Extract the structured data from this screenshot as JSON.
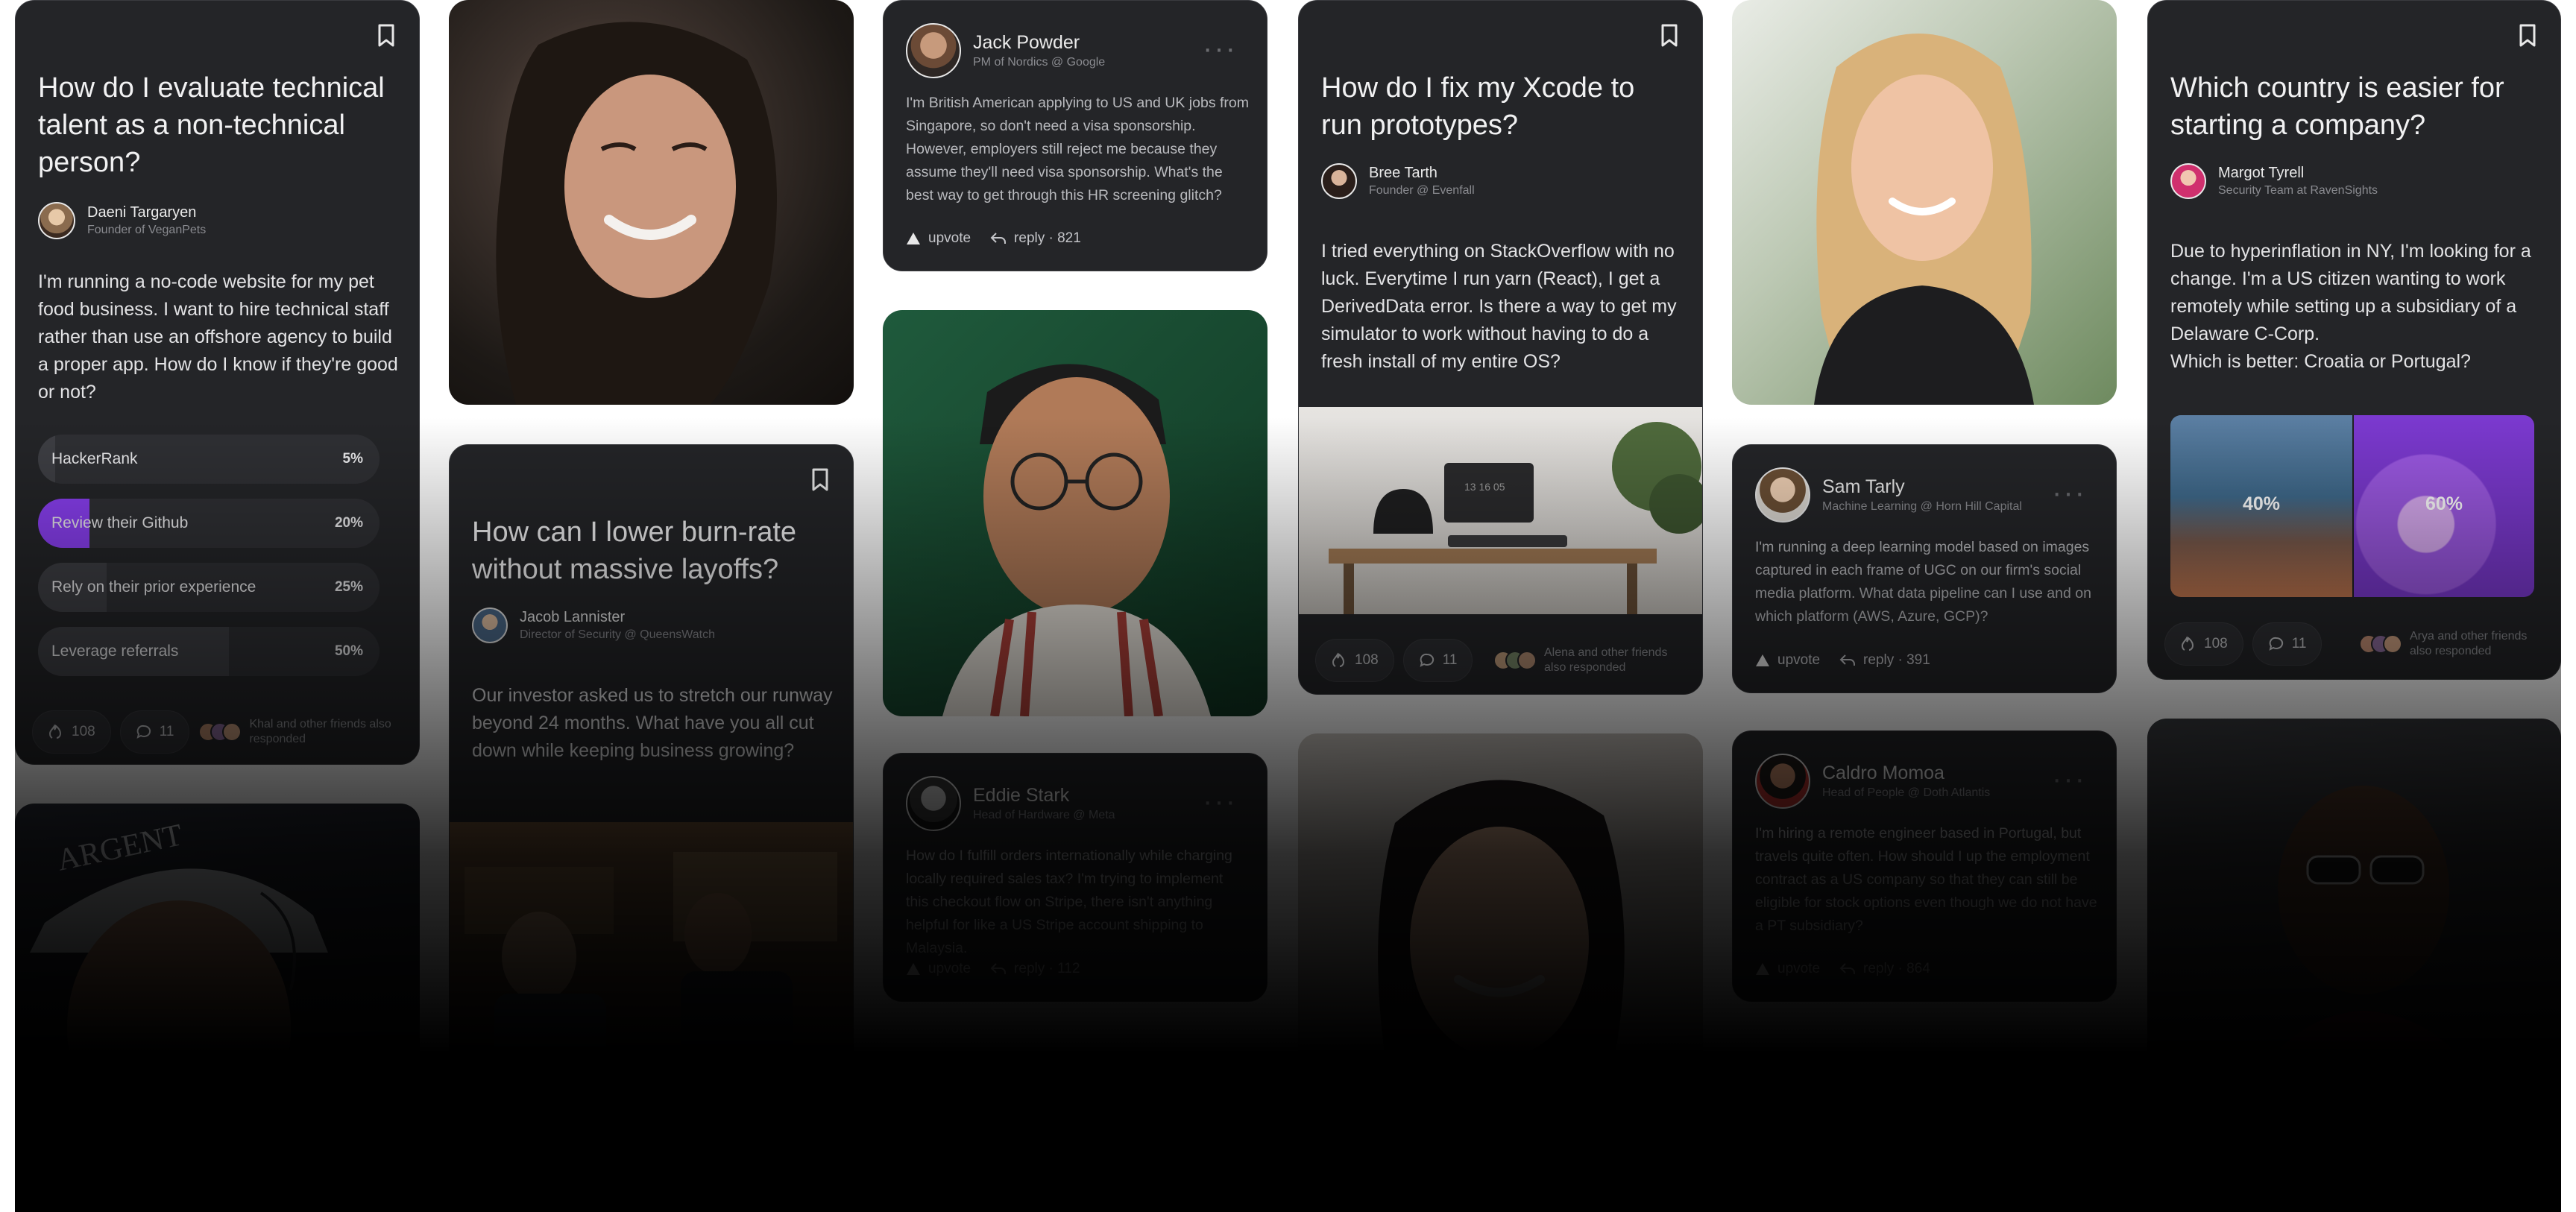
{
  "cards": {
    "tech_talent": {
      "title": "How do I evaluate technical talent as a non-technical person?",
      "author_name": "Daeni Targaryen",
      "author_role": "Founder of VeganPets",
      "body": "I'm running a no-code website for my pet food business. I want to hire technical staff rather than use an offshore agency to build a proper app. How do I know if they're good or not?",
      "poll": [
        {
          "label": "HackerRank",
          "percent": "5%",
          "fraction": 0.05
        },
        {
          "label": "Review their Github",
          "percent": "20%",
          "fraction": 0.15
        },
        {
          "label": "Rely on their prior experience",
          "percent": "25%",
          "fraction": 0.2
        },
        {
          "label": "Leverage referrals",
          "percent": "50%",
          "fraction": 0.56
        }
      ],
      "likes": "108",
      "comments": "11",
      "friends_text": "Khal and other friends also responded"
    },
    "burn_rate": {
      "title": "How can I lower burn-rate without massive layoffs?",
      "author_name": "Jacob Lannister",
      "author_role": "Director of Security @ QueensWatch",
      "body": "Our investor asked us to stretch our runway beyond 24 months. What have you all cut down while keeping business growing?"
    },
    "jack": {
      "author_name": "Jack Powder",
      "author_role": "PM of Nordics @ Google",
      "body": "I'm British American applying to US and UK jobs from Singapore, so don't need a visa sponsorship. However, employers still reject me because they assume they'll need visa sponsorship. What's the best way to get through this HR screening glitch?",
      "upvote_label": "upvote",
      "reply_label": "reply · 821"
    },
    "eddie": {
      "author_name": "Eddie Stark",
      "author_role": "Head of Hardware @ Meta",
      "body": "How do I fulfill orders internationally while charging locally required sales tax? I'm trying to implement this checkout flow on Stripe, there isn't anything helpful for like a US Stripe account shipping to Malaysia.",
      "upvote_label": "upvote",
      "reply_label": "reply · 112"
    },
    "xcode": {
      "title": "How do I fix my Xcode to run prototypes?",
      "author_name": "Bree Tarth",
      "author_role": "Founder @ Evenfall",
      "body": "I tried everything on StackOverflow with no luck. Everytime I run yarn (React), I get a DerivedData error. Is there a way to get my simulator to work without having to do a fresh install of my entire OS?",
      "monitor_text": "13 16 05",
      "likes": "108",
      "comments": "11",
      "friends_text": "Alena and other friends also responded"
    },
    "sam": {
      "author_name": "Sam Tarly",
      "author_role": "Machine Learning @ Horn Hill Capital",
      "body": "I'm running a deep learning model based on images captured in each frame of UGC on our firm's social media platform. What data pipeline can I use and on which platform (AWS, Azure, GCP)?",
      "upvote_label": "upvote",
      "reply_label": "reply · 391"
    },
    "caldro": {
      "author_name": "Caldro Momoa",
      "author_role": "Head of People @ Doth Atlantis",
      "body": "I'm hiring a remote engineer based in Portugal, but travels quite often. How should I up the employment contract as a US company so that they can still be eligible for stock options even though we do not have a PT subsidiary?",
      "upvote_label": "upvote",
      "reply_label": "reply · 864"
    },
    "country": {
      "title": "Which country is easier for starting a company?",
      "author_name": "Margot Tyrell",
      "author_role": "Security Team at RavenSights",
      "body_lines": [
        "Due to hyperinflation in NY, I'm looking for a change. I'm a US citizen wanting to work remotely while setting up a subsidiary of a Delaware C-Corp.",
        "Which is better: Croatia or Portugal?"
      ],
      "option_a_percent": "40%",
      "option_b_percent": "60%",
      "likes": "108",
      "comments": "11",
      "friends_text": "Arya and other friends also responded"
    }
  },
  "colors": {
    "card_bg": "#242528",
    "accent_purple": "#8a3ff2",
    "pill_bg": "#2f3034"
  },
  "icons": [
    "bookmark-icon",
    "more-dots-icon",
    "like-icon",
    "comment-icon",
    "upvote-icon",
    "reply-icon"
  ]
}
